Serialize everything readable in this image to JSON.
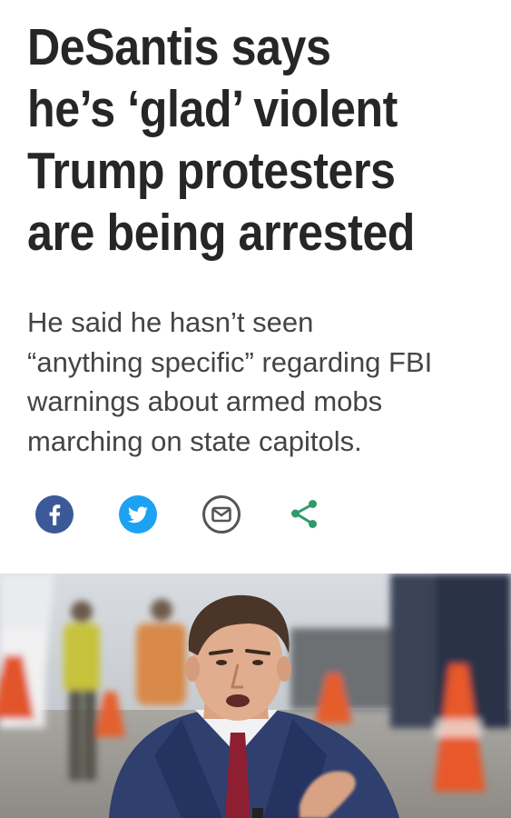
{
  "article": {
    "headline_lines": [
      "DeSantis says",
      "he’s ‘glad’ violent",
      "Trump protesters",
      "are being arrested"
    ],
    "subhead_lines": [
      "He said he hasn’t seen",
      "“anything specific” regarding FBI",
      "warnings about armed mobs",
      "marching on state capitols."
    ]
  },
  "share": {
    "buttons": [
      {
        "name": "facebook",
        "icon": "facebook-icon",
        "color": "#3b5998"
      },
      {
        "name": "twitter",
        "icon": "twitter-icon",
        "color": "#1da1f2"
      },
      {
        "name": "email",
        "icon": "envelope-icon",
        "color": "#555555"
      },
      {
        "name": "share",
        "icon": "share-icon",
        "color": "#2e9b6a"
      }
    ]
  },
  "photo": {
    "subject": "man in blue suit speaking outdoors"
  }
}
